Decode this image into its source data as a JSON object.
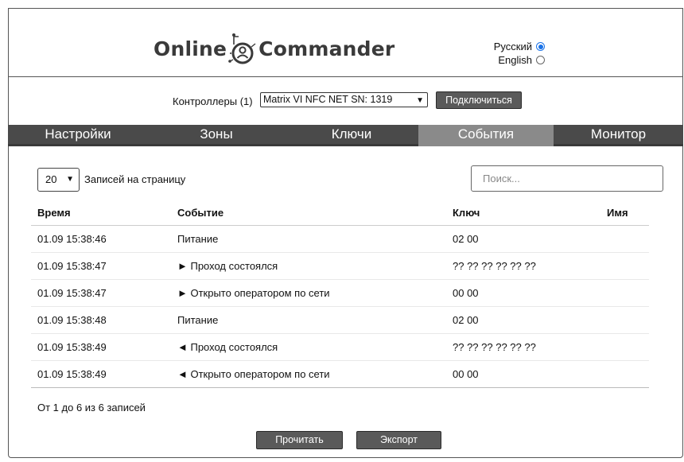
{
  "logo": {
    "left": "Online",
    "right": "Commander"
  },
  "language": {
    "options": [
      "Русский",
      "English"
    ],
    "selected": "Русский"
  },
  "controllers": {
    "label": "Контроллеры (1)",
    "selected": "Matrix VI NFC NET SN: 1319",
    "connect_label": "Подключиться"
  },
  "tabs": [
    "Настройки",
    "Зоны",
    "Ключи",
    "События",
    "Монитор"
  ],
  "active_tab": "События",
  "list": {
    "per_page_value": "20",
    "per_page_label": "Записей на страницу",
    "search_placeholder": "Поиск...",
    "columns": [
      "Время",
      "Событие",
      "Ключ",
      "Имя"
    ],
    "rows": [
      {
        "time": "01.09 15:38:46",
        "event": "Питание",
        "key": "02 00",
        "name": ""
      },
      {
        "time": "01.09 15:38:47",
        "event": "► Проход состоялся",
        "key": "?? ?? ?? ?? ?? ??",
        "name": ""
      },
      {
        "time": "01.09 15:38:47",
        "event": "► Открыто оператором по сети",
        "key": "00 00",
        "name": ""
      },
      {
        "time": "01.09 15:38:48",
        "event": "Питание",
        "key": "02 00",
        "name": ""
      },
      {
        "time": "01.09 15:38:49",
        "event": "◄ Проход состоялся",
        "key": "?? ?? ?? ?? ?? ??",
        "name": ""
      },
      {
        "time": "01.09 15:38:49",
        "event": "◄ Открыто оператором по сети",
        "key": "00 00",
        "name": ""
      }
    ],
    "info": "От 1 до 6 из 6 записей"
  },
  "actions": {
    "read_label": "Прочитать",
    "export_label": "Экспорт"
  },
  "colors": {
    "tab_bg": "#4a4a4a",
    "tab_active_bg": "#8a8a8a",
    "button_bg": "#5a5a5a",
    "radio_accent": "#1a73e8"
  },
  "icons": {
    "logo": "user-gear-icon"
  }
}
